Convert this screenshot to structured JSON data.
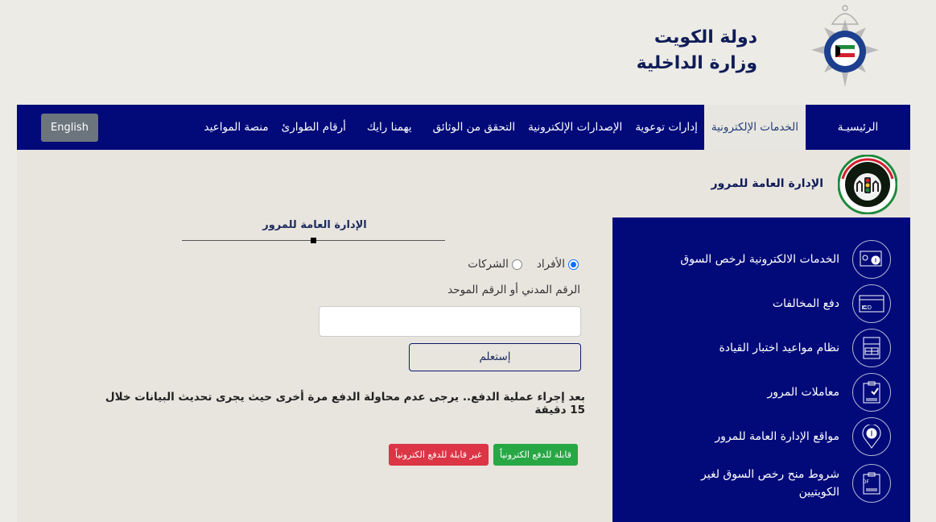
{
  "header": {
    "state_name": "دولة الكويت",
    "ministry_name": "وزارة الداخلية",
    "logo_icon": "kuwait-police-emblem"
  },
  "nav": {
    "items": [
      {
        "label": "الرئيسيـة",
        "active": false
      },
      {
        "label": "الخدمات الإلكترونية",
        "active": true
      },
      {
        "label": "إدارات توعوية",
        "active": false
      },
      {
        "label": "الإصدارات الإلكترونية",
        "active": false
      },
      {
        "label": "التحقق من الوثائق",
        "active": false
      },
      {
        "label": "يهمنا رايك",
        "active": false
      },
      {
        "label": "أرقام الطوارئ",
        "active": false
      },
      {
        "label": "منصة المواعيد",
        "active": false
      }
    ],
    "language_button": "English"
  },
  "department": {
    "title": "الإدارة العامة للمرور",
    "logo_icon": "traffic-department-emblem"
  },
  "sidebar": {
    "items": [
      {
        "label": "الخدمات الالكترونية لرخص السوق",
        "icon": "license-card-icon"
      },
      {
        "label": "دفع المخالفات",
        "icon": "kd-payment-card-icon"
      },
      {
        "label": "نظام مواعيد اختبار القيادة",
        "icon": "calendar-icon"
      },
      {
        "label": "معاملات المرور",
        "icon": "clipboard-check-icon"
      },
      {
        "label": "مواقع الإدارة العامة للمرور",
        "icon": "location-pin-icon"
      },
      {
        "label": "شروط منح رخص السوق لغير الكويتيين",
        "icon": "pdf-document-icon"
      }
    ]
  },
  "form": {
    "title": "الإدارة العامة للمرور",
    "radio_options": [
      {
        "label": "الأفراد",
        "checked": true
      },
      {
        "label": "الشركات",
        "checked": false
      }
    ],
    "field_label": "الرقم المدني أو الرقم الموحد",
    "civil_id_value": "",
    "civil_id_placeholder": "",
    "submit_label": "إستعلم",
    "notice": "بعد إجراء عملية الدفع.. يرجى عدم محاولة الدفع مرة أخرى حيث يجرى تحديث البيانات خلال 15 دقيقة",
    "badges": [
      {
        "label": "قابلة للدفع الكترونياً",
        "color": "#28a745"
      },
      {
        "label": "غير قابلة للدفع الكترونياً",
        "color": "#dc3545"
      }
    ]
  },
  "colors": {
    "nav_bg": "#020a7a",
    "page_bg": "#ecebe6",
    "brand_text": "#0f1c57"
  }
}
